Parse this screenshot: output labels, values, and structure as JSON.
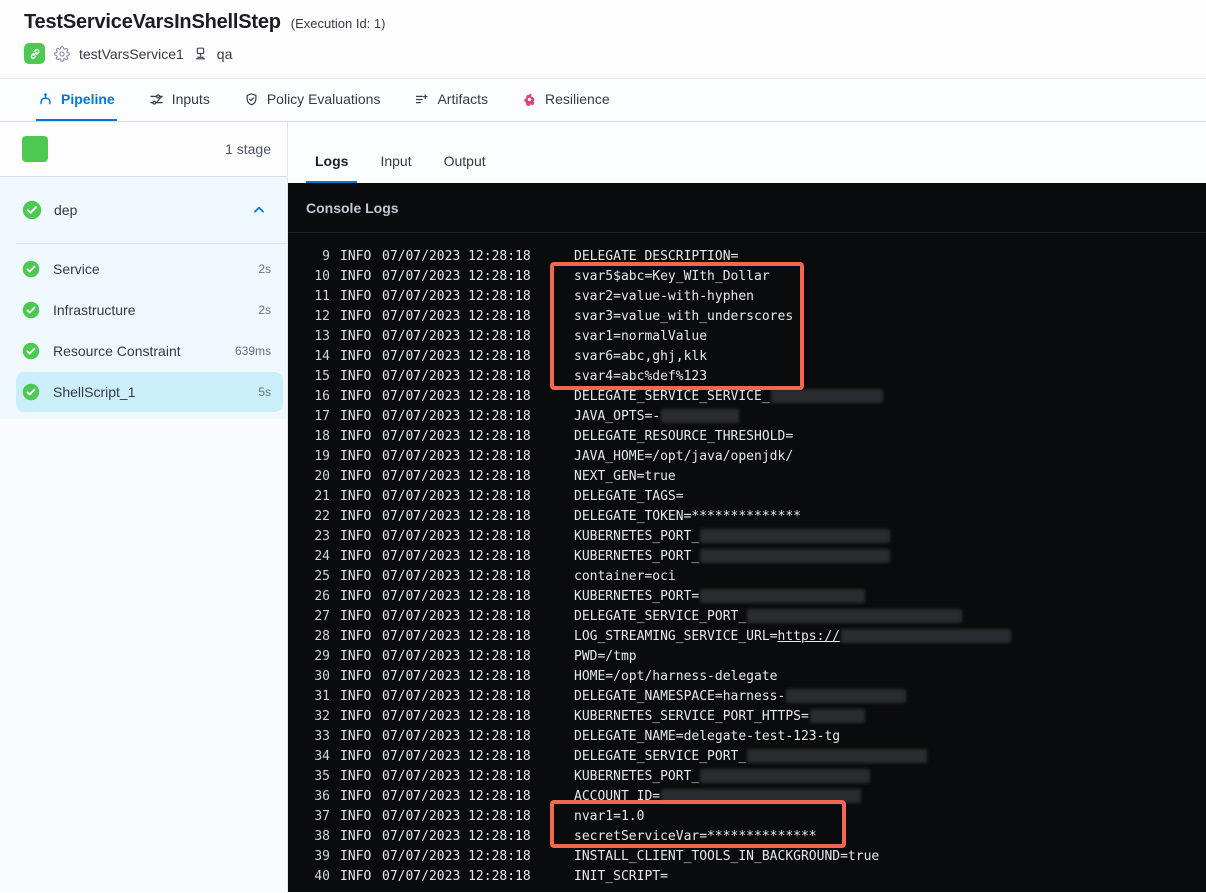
{
  "header": {
    "title": "TestServiceVarsInShellStep",
    "execution_id": "(Execution Id: 1)",
    "service_icon": "link-icon",
    "settings_icon": "gear-icon",
    "service_name": "testVarsService1",
    "environment_icon": "environment-icon",
    "environment_name": "qa"
  },
  "tabs": [
    {
      "label": "Pipeline",
      "icon": "pipeline-icon",
      "active": true
    },
    {
      "label": "Inputs",
      "icon": "inputs-icon",
      "active": false
    },
    {
      "label": "Policy Evaluations",
      "icon": "shield-check-icon",
      "active": false
    },
    {
      "label": "Artifacts",
      "icon": "list-plus-icon",
      "active": false
    },
    {
      "label": "Resilience",
      "icon": "chaos-icon",
      "active": false
    }
  ],
  "sidebar": {
    "stage_count": "1 stage",
    "group": {
      "label": "dep",
      "status": "success",
      "expanded": true
    },
    "steps": [
      {
        "label": "Service",
        "duration": "2s",
        "status": "success",
        "selected": false
      },
      {
        "label": "Infrastructure",
        "duration": "2s",
        "status": "success",
        "selected": false
      },
      {
        "label": "Resource Constraint",
        "duration": "639ms",
        "status": "success",
        "selected": false
      },
      {
        "label": "ShellScript_1",
        "duration": "5s",
        "status": "success",
        "selected": true
      }
    ]
  },
  "console": {
    "tabs": [
      {
        "label": "Logs",
        "active": true
      },
      {
        "label": "Input",
        "active": false
      },
      {
        "label": "Output",
        "active": false
      }
    ],
    "title": "Console Logs",
    "log_level": "INFO",
    "timestamp": "07/07/2023 12:28:18",
    "highlights": [
      {
        "lines": [
          10,
          15
        ],
        "color": "#f2684f"
      },
      {
        "lines": [
          37,
          38
        ],
        "color": "#f2684f"
      }
    ],
    "lines": [
      {
        "num": 9,
        "parts": [
          {
            "text": "DELEGATE_DESCRIPTION="
          }
        ]
      },
      {
        "num": 10,
        "parts": [
          {
            "text": "svar5$abc=Key_WIth_Dollar"
          }
        ]
      },
      {
        "num": 11,
        "parts": [
          {
            "text": "svar2=value-with-hyphen"
          }
        ]
      },
      {
        "num": 12,
        "parts": [
          {
            "text": "svar3=value_with_underscores"
          }
        ]
      },
      {
        "num": 13,
        "parts": [
          {
            "text": "svar1=normalValue"
          }
        ]
      },
      {
        "num": 14,
        "parts": [
          {
            "text": "svar6=abc,ghj,klk"
          }
        ]
      },
      {
        "num": 15,
        "parts": [
          {
            "text": "svar4=abc%def%123"
          }
        ]
      },
      {
        "num": 16,
        "parts": [
          {
            "text": "DELEGATE_SERVICE_SERVICE_"
          },
          {
            "redacted": 112
          }
        ]
      },
      {
        "num": 17,
        "parts": [
          {
            "text": "JAVA_OPTS=-"
          },
          {
            "redacted": 78
          }
        ]
      },
      {
        "num": 18,
        "parts": [
          {
            "text": "DELEGATE_RESOURCE_THRESHOLD="
          }
        ]
      },
      {
        "num": 19,
        "parts": [
          {
            "text": "JAVA_HOME=/opt/java/openjdk/"
          }
        ]
      },
      {
        "num": 20,
        "parts": [
          {
            "text": "NEXT_GEN=true"
          }
        ]
      },
      {
        "num": 21,
        "parts": [
          {
            "text": "DELEGATE_TAGS="
          }
        ]
      },
      {
        "num": 22,
        "parts": [
          {
            "text": "DELEGATE_TOKEN=**************"
          }
        ]
      },
      {
        "num": 23,
        "parts": [
          {
            "text": "KUBERNETES_PORT_"
          },
          {
            "redacted": 190
          }
        ]
      },
      {
        "num": 24,
        "parts": [
          {
            "text": "KUBERNETES_PORT_"
          },
          {
            "redacted": 190
          }
        ]
      },
      {
        "num": 25,
        "parts": [
          {
            "text": "container=oci"
          }
        ]
      },
      {
        "num": 26,
        "parts": [
          {
            "text": "KUBERNETES_PORT="
          },
          {
            "redacted": 165
          }
        ]
      },
      {
        "num": 27,
        "parts": [
          {
            "text": "DELEGATE_SERVICE_PORT_"
          },
          {
            "redacted": 215
          }
        ]
      },
      {
        "num": 28,
        "parts": [
          {
            "text": "LOG_STREAMING_SERVICE_URL="
          },
          {
            "link": "https://"
          },
          {
            "redacted": 170
          }
        ]
      },
      {
        "num": 29,
        "parts": [
          {
            "text": "PWD=/tmp"
          }
        ]
      },
      {
        "num": 30,
        "parts": [
          {
            "text": "HOME=/opt/harness-delegate"
          }
        ]
      },
      {
        "num": 31,
        "parts": [
          {
            "text": "DELEGATE_NAMESPACE=harness-"
          },
          {
            "redacted": 120
          }
        ]
      },
      {
        "num": 32,
        "parts": [
          {
            "text": "KUBERNETES_SERVICE_PORT_HTTPS="
          },
          {
            "redacted": 55
          }
        ]
      },
      {
        "num": 33,
        "parts": [
          {
            "text": "DELEGATE_NAME=delegate-test-123-tg"
          }
        ]
      },
      {
        "num": 34,
        "parts": [
          {
            "text": "DELEGATE_SERVICE_PORT_"
          },
          {
            "redacted": 180
          }
        ]
      },
      {
        "num": 35,
        "parts": [
          {
            "text": "KUBERNETES_PORT_"
          },
          {
            "redacted": 170
          }
        ]
      },
      {
        "num": 36,
        "parts": [
          {
            "text": "ACCOUNT_ID="
          },
          {
            "redacted": 200
          }
        ]
      },
      {
        "num": 37,
        "parts": [
          {
            "text": "nvar1=1.0"
          }
        ]
      },
      {
        "num": 38,
        "parts": [
          {
            "text": "secretServiceVar=**************"
          }
        ]
      },
      {
        "num": 39,
        "parts": [
          {
            "text": "INSTALL_CLIENT_TOOLS_IN_BACKGROUND=true"
          }
        ]
      },
      {
        "num": 40,
        "parts": [
          {
            "text": "INIT_SCRIPT="
          }
        ]
      }
    ]
  },
  "colors": {
    "accent_blue": "#0278d5",
    "success_green": "#4dc952",
    "highlight_red": "#f2684f",
    "console_bg": "#0a0b0d",
    "steps_panel_bg": "#eef8fd",
    "selected_step_bg": "#cbeffa",
    "resilience_pink": "#e0447c"
  }
}
